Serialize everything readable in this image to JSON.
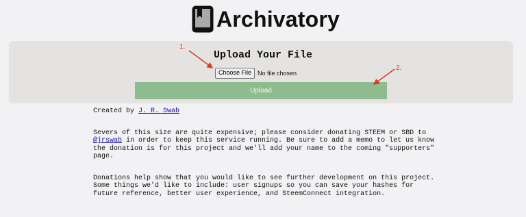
{
  "brand": {
    "name": "Archivatory",
    "icon": "bookmark-book-icon"
  },
  "upload_panel": {
    "title": "Upload Your File",
    "choose_file_label": "Choose File",
    "file_status": "No file chosen",
    "upload_label": "Upload"
  },
  "annotations": {
    "step1": "1.",
    "step2": "2."
  },
  "footer": {
    "created_by_prefix": "Created by",
    "author": "J. R. Swab",
    "donation_prefix": "Severs of this size are quite expensive; please consider donating STEEM or SBD to ",
    "donation_handle": "@jrswab",
    "donation_suffix": " in order to keep this service running. Be sure to add a memo to let us know the donation is for this project and we'll add your name to the coming \"supporters\" page.",
    "development_text": "Donations help show that you would like to see further development on this project. Some things we'd like to include: user signups so you can save your hashes for future reference, better user experience, and SteemConnect integration."
  },
  "colors": {
    "background": "#f2f2f4",
    "panel": "#e4e3e1",
    "upload_button": "#8fbc8f",
    "annotation": "#d83a1a",
    "link": "#1a0dab"
  }
}
